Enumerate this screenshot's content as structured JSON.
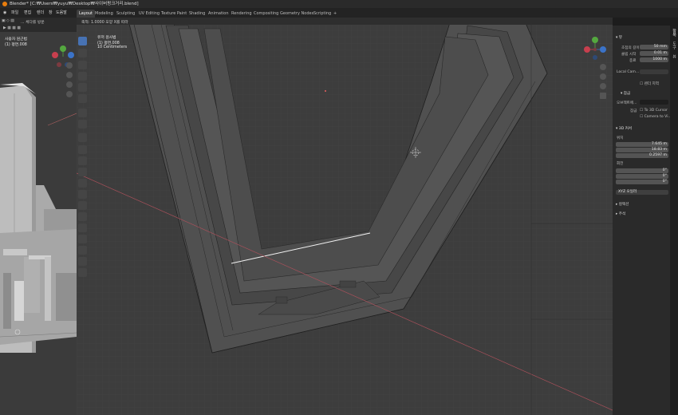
{
  "window": {
    "title": "Blender* [C:₩Users₩yuyu₩Desktop₩사이버펑크거리.blend]"
  },
  "menu": {
    "items": [
      "파일",
      "편집",
      "렌더",
      "창",
      "도움말"
    ],
    "workspaces": [
      "Layout",
      "Modeling",
      "Sculpting",
      "UV Editing",
      "Texture Paint",
      "Shading",
      "Animation",
      "Rendering",
      "Compositing",
      "Geometry Nodes",
      "Scripting",
      "+"
    ]
  },
  "left_viewport": {
    "header_text": "... 체다를 방문",
    "overlay_line1": "사용자 원근법",
    "overlay_line2": "(1) 평면.008"
  },
  "main_viewport": {
    "header_text": "축적: 1.0000 모양 X를 따라",
    "overlay_line1": "유저 원사법",
    "overlay_line2": "(1) 평면.008",
    "overlay_line3": "10 Centimeters"
  },
  "npanel": {
    "view_section": "뷰",
    "focal_label": "초점의 길이",
    "focal_value": "50 mm",
    "clip_start_label": "클립 시작",
    "clip_start_value": "0.01 m",
    "clip_end_label": "종료",
    "clip_end_value": "1000 m",
    "local_camera_label": "Local Cam...",
    "render_region_label": "렌더 지역",
    "lock_section": "잠금",
    "lock_object_label": "오브젝트에...",
    "lock_label": "잠금",
    "to_3d_cursor": "To 3D Cursor",
    "camera_to_view": "Camera to Vi...",
    "cursor_section": "3D 커서",
    "location_label": "위치",
    "loc_x": "7.645 m",
    "loc_y": "18.83 m",
    "loc_z": "0.2597 m",
    "rotation_label": "회전",
    "rot_x": "0°",
    "rot_y": "0°",
    "rot_z": "0°",
    "rotation_mode": "XYZ 오일러",
    "collections_section": "컬렉션",
    "annotations_section": "주석",
    "axis_x": "X",
    "axis_y": "Y",
    "axis_z": "Z"
  },
  "sidetabs": [
    "항목",
    "도구",
    "뷰"
  ],
  "colors": {
    "accent": "#4772b3",
    "active_tool": "#4772b3",
    "cursor": "#e86060"
  }
}
